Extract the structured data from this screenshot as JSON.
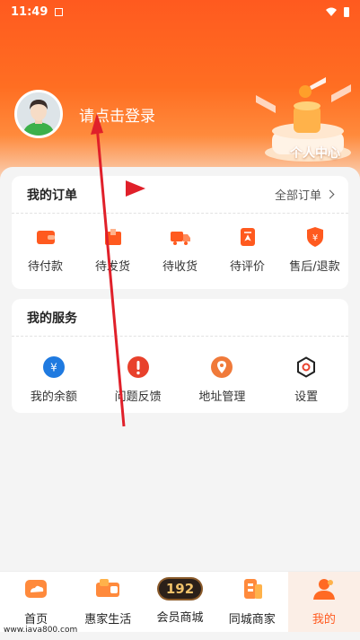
{
  "status_bar": {
    "time": "11:49"
  },
  "header": {
    "login_prompt": "请点击登录",
    "deco_label": "个人中心"
  },
  "orders": {
    "title": "我的订单",
    "more_label": "全部订单",
    "items": [
      {
        "label": "待付款",
        "icon": "wallet-icon"
      },
      {
        "label": "待发货",
        "icon": "package-icon"
      },
      {
        "label": "待收货",
        "icon": "truck-icon"
      },
      {
        "label": "待评价",
        "icon": "review-icon"
      },
      {
        "label": "售后/退款",
        "icon": "refund-shield-icon"
      }
    ]
  },
  "services": {
    "title": "我的服务",
    "items": [
      {
        "label": "我的余额",
        "icon": "yen-coin-icon"
      },
      {
        "label": "问题反馈",
        "icon": "exclamation-icon"
      },
      {
        "label": "地址管理",
        "icon": "location-pin-icon"
      },
      {
        "label": "设置",
        "icon": "gear-icon"
      }
    ]
  },
  "tabbar": {
    "items": [
      {
        "label": "首页",
        "icon": "home-cloud-icon"
      },
      {
        "label": "惠家生活",
        "icon": "cart-icon"
      },
      {
        "label": "会员商城",
        "badge": "192"
      },
      {
        "label": "同城商家",
        "icon": "shop-icon"
      },
      {
        "label": "我的",
        "icon": "person-icon",
        "active": true
      }
    ]
  },
  "watermark": "www.java800.com",
  "colors": {
    "accent": "#ff5a1f",
    "accent_light": "#ff8a3c",
    "annotation_red": "#e0202a"
  }
}
